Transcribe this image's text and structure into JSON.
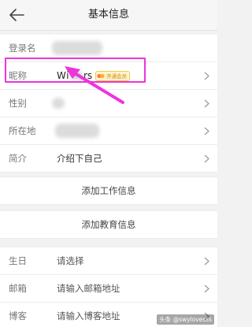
{
  "header": {
    "title": "基本信息",
    "back_icon": "back-arrow-icon"
  },
  "profile": {
    "login_label": "登录名",
    "nickname_label": "昵称",
    "nickname_prefix": "Wi",
    "nickname_suffix": "rs",
    "vip_badge": "开通会员",
    "gender_label": "性别",
    "location_label": "所在地",
    "intro_label": "简介",
    "intro_value": "介绍下自己"
  },
  "actions": {
    "add_work": "添加工作信息",
    "add_education": "添加教育信息"
  },
  "details": {
    "birthday_label": "生日",
    "birthday_placeholder": "请选择",
    "email_label": "邮箱",
    "email_placeholder": "请输入邮箱地址",
    "blog_label": "博客",
    "blog_placeholder": "请输入博客地址"
  },
  "watermark": "头条 @swylovesss",
  "colors": {
    "highlight": "#ee33dd",
    "vip_badge": "#f2c94c",
    "background": "#f2f2f2"
  }
}
